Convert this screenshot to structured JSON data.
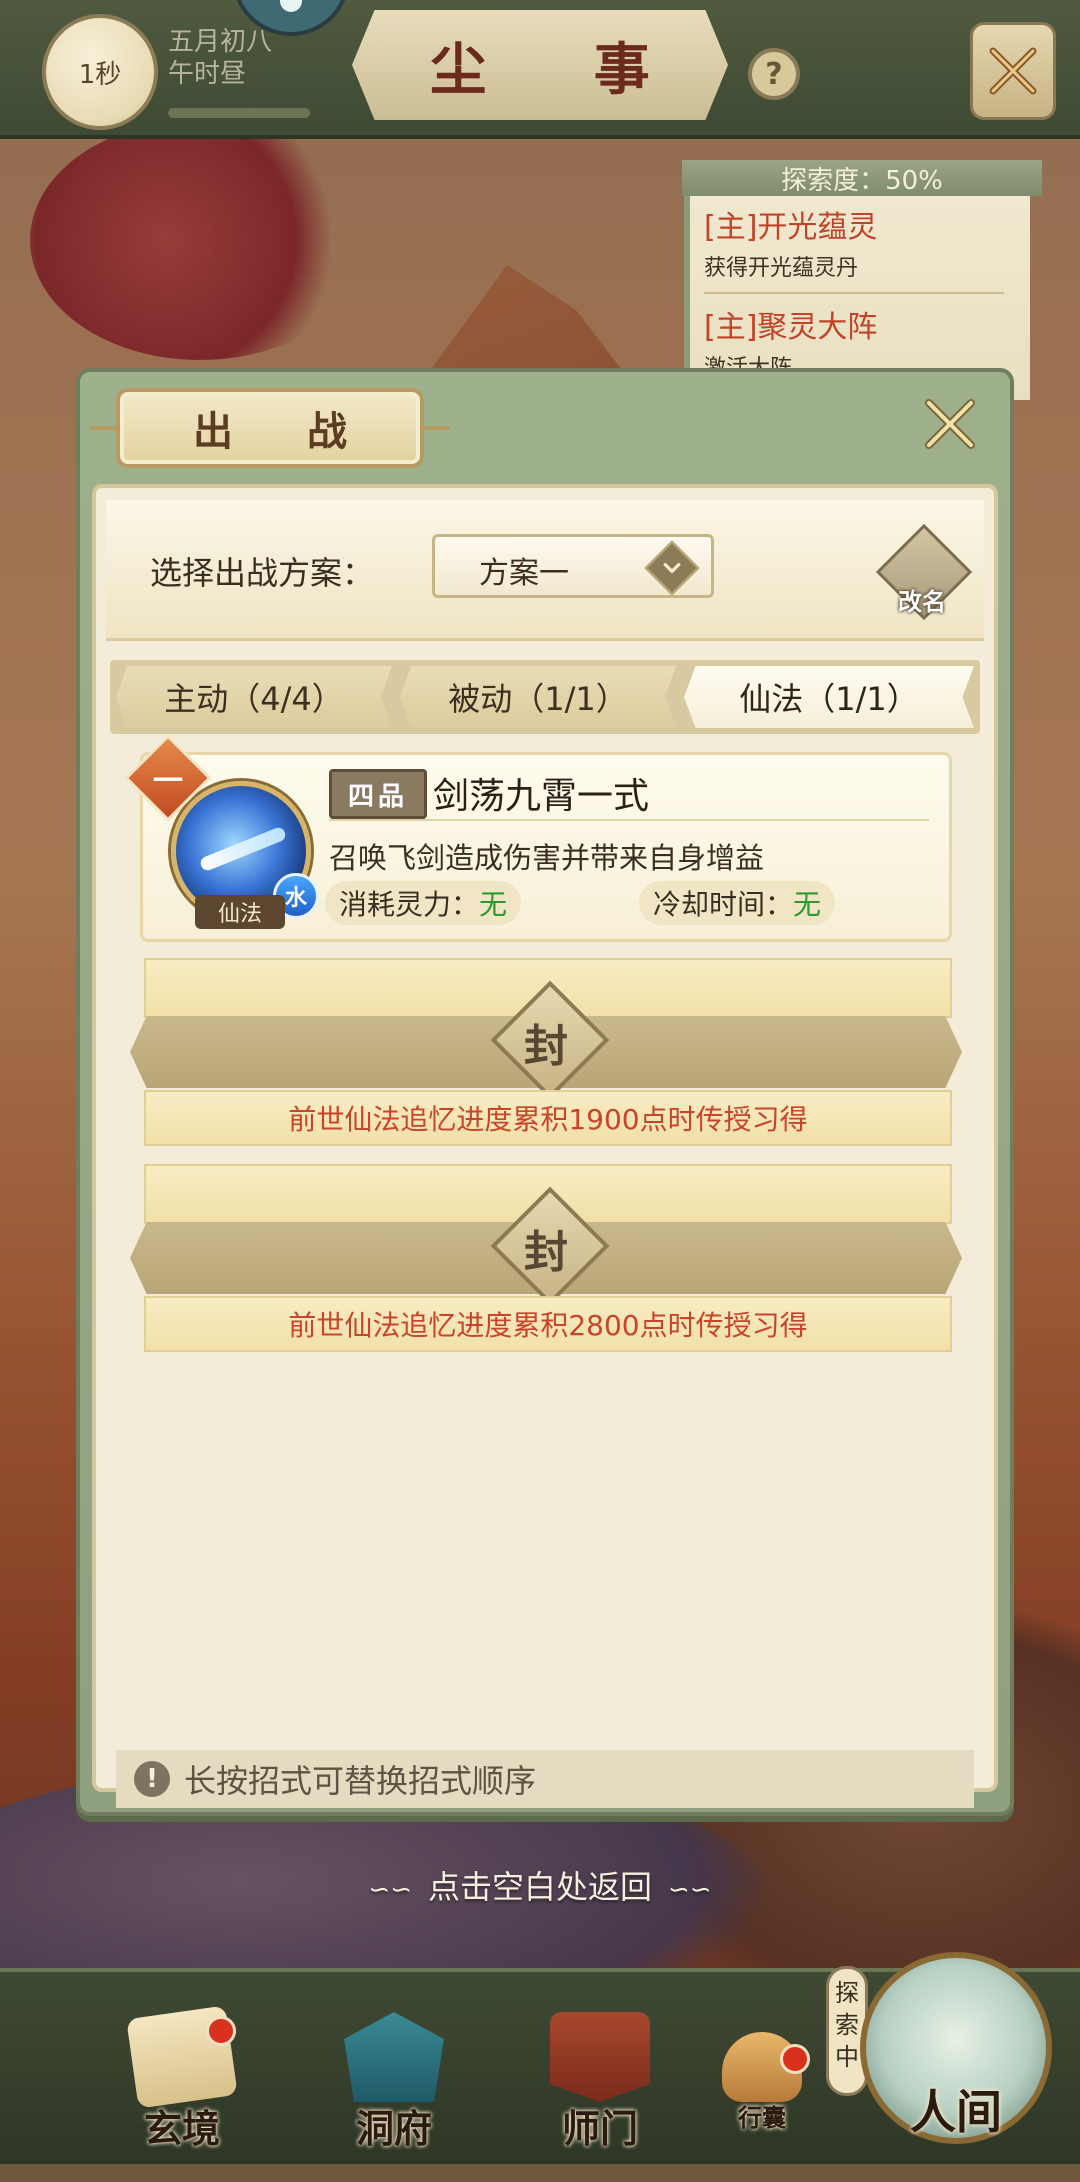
{
  "topbar": {
    "timer": "1秒",
    "date_line1": "五月初八",
    "date_line2": "午时昼",
    "title": "尘 事",
    "help_glyph": "?"
  },
  "explore": {
    "progress": "探索度：50%",
    "quests": [
      {
        "title": "[主]开光蕴灵",
        "desc": "获得开光蕴灵丹"
      },
      {
        "title": "[主]聚灵大阵",
        "desc": "激活大阵"
      }
    ]
  },
  "modal": {
    "title": "出 战",
    "plan_label": "选择出战方案：",
    "plan_value": "方案一",
    "rename_label": "改名",
    "tabs": [
      {
        "label": "主动（4/4）",
        "active": false
      },
      {
        "label": "被动（1/1）",
        "active": false
      },
      {
        "label": "仙法（1/1）",
        "active": true
      }
    ],
    "skill": {
      "slot": "一",
      "grade": "四品",
      "name": "剑荡九霄一式",
      "element": "水",
      "type": "仙法",
      "description": "召唤飞剑造成伤害并带来自身增益",
      "cost_label": "消耗灵力：",
      "cost_value": "无",
      "cooldown_label": "冷却时间：",
      "cooldown_value": "无"
    },
    "locked_slots": [
      {
        "seal": "封",
        "text": "前世仙法追忆进度累积1900点时传授习得"
      },
      {
        "seal": "封",
        "text": "前世仙法追忆进度累积2800点时传授习得"
      }
    ],
    "hint": "长按招式可替换招式顺序",
    "hint_icon": "!"
  },
  "tap_to_return": "点击空白处返回",
  "bottom_nav": {
    "items": [
      {
        "label": "玄境",
        "icon": "scroll-icon",
        "has_dot": true
      },
      {
        "label": "洞府",
        "icon": "pavilion-icon",
        "has_dot": false
      },
      {
        "label": "师门",
        "icon": "banner-icon",
        "has_dot": false
      },
      {
        "label": "行囊",
        "icon": "bag-icon",
        "has_dot": true
      }
    ],
    "exploring_label": "探索中",
    "world_label": "人间"
  },
  "colors": {
    "accent_red": "#c8442a",
    "value_green": "#2c9a2c",
    "frame_green": "#8fa07e"
  }
}
